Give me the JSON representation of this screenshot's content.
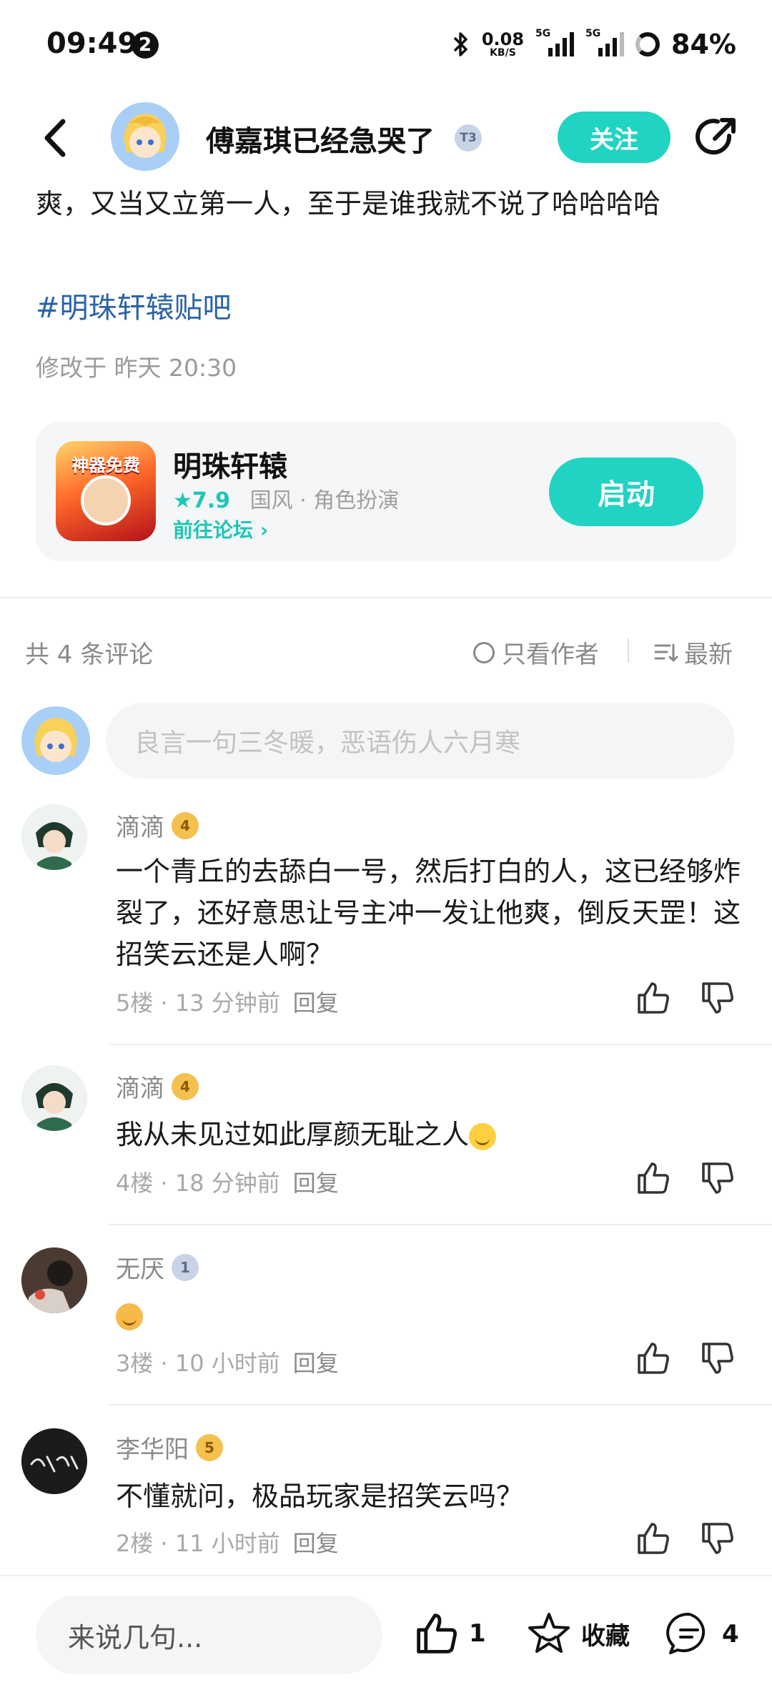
{
  "status": {
    "time": "09:49",
    "notification_count": "2",
    "net_speed": "0.08",
    "net_unit": "KB/S",
    "sig1_tag": "5G",
    "sig2_tag": "5G",
    "battery": "84%"
  },
  "header": {
    "author_name": "傅嘉琪已经急哭了",
    "author_level": "T3",
    "follow_label": "关注"
  },
  "post": {
    "text": "爽，又当又立第一人，至于是谁我就不说了哈哈哈哈",
    "hashtag": "#明珠轩辕贴吧",
    "modified": "修改于 昨天 20:30"
  },
  "game": {
    "icon_text": "神器免费",
    "title": "明珠轩辕",
    "score": "★7.9",
    "tags": "国风 · 角色扮演",
    "forum_link": "前往论坛 ›",
    "launch_label": "启动"
  },
  "comments_header": {
    "count": "共 4 条评论",
    "author_only": "只看作者",
    "sort": "最新"
  },
  "comment_input": {
    "placeholder": "良言一句三冬暖，恶语伤人六月寒"
  },
  "comments": [
    {
      "name": "滴滴",
      "level": "4",
      "text": "一个青丘的去舔白一号，然后打白的人，这已经够炸裂了，还好意思让号主冲一发让他爽，倒反天罡！这招笑云还是人啊？",
      "floor": "5楼 · 13 分钟前",
      "reply": "回复"
    },
    {
      "name": "滴滴",
      "level": "4",
      "text": "我从未见过如此厚颜无耻之人",
      "floor": "4楼 · 18 分钟前",
      "reply": "回复"
    },
    {
      "name": "无厌",
      "level": "1",
      "text": "",
      "floor": "3楼 · 10 小时前",
      "reply": "回复"
    },
    {
      "name": "李华阳",
      "level": "5",
      "text": "不懂就问，极品玩家是招笑云吗？",
      "floor": "2楼 · 11 小时前",
      "reply": "回复"
    }
  ],
  "bottom": {
    "input_placeholder": "来说几句...",
    "like_count": "1",
    "collect_label": "收藏",
    "comment_count": "4"
  },
  "colors": {
    "accent": "#20d3c2",
    "link": "#2a63a6"
  }
}
